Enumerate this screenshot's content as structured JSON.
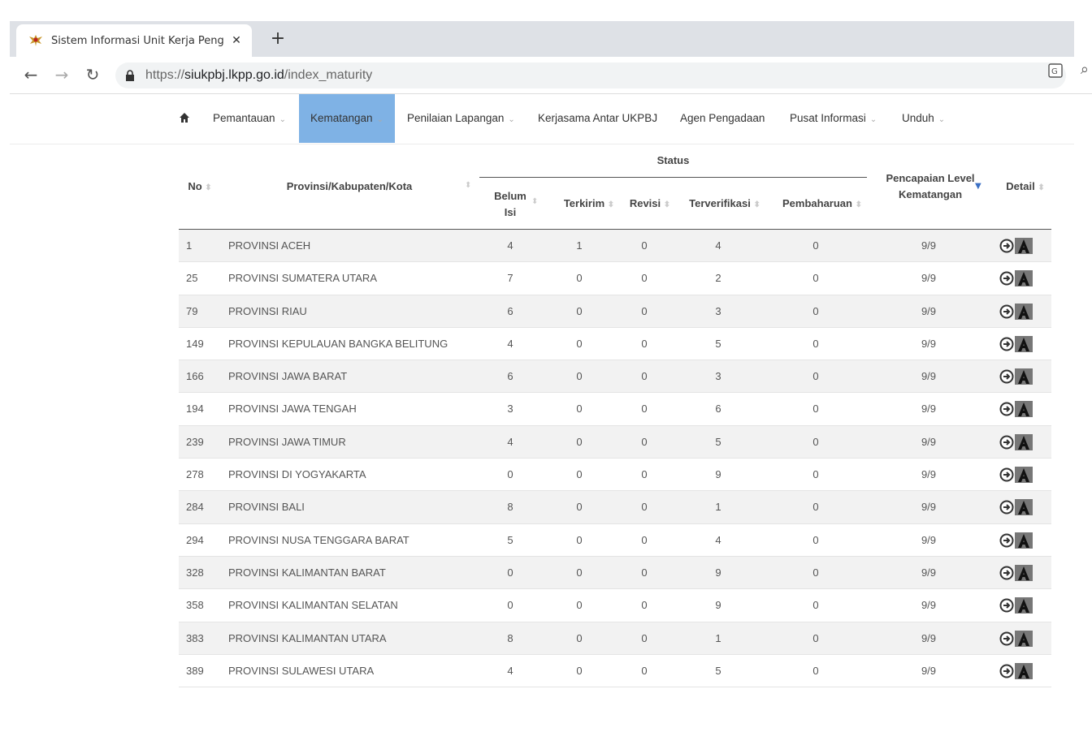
{
  "browser": {
    "tab_title": "Sistem Informasi Unit Kerja Peng",
    "url_proto": "https://",
    "url_host": "siukpbj.lkpp.go.id",
    "url_path": "/index_maturity"
  },
  "nav": {
    "items": [
      {
        "label": "Pemantauan",
        "chevron": true
      },
      {
        "label": "Kematangan",
        "chevron": true,
        "active": true
      },
      {
        "label": "Penilaian Lapangan",
        "chevron": true
      },
      {
        "label": "Kerjasama Antar UKPBJ",
        "chevron": false
      },
      {
        "label": "Agen Pengadaan",
        "chevron": false
      },
      {
        "label": "Pusat Informasi",
        "chevron": true
      },
      {
        "label": "Unduh",
        "chevron": true
      }
    ]
  },
  "table": {
    "headers": {
      "no": "No",
      "prov": "Provinsi/Kabupaten/Kota",
      "status": "Status",
      "belum_1": "Belum",
      "belum_2": "Isi",
      "terkirim": "Terkirim",
      "revisi": "Revisi",
      "terverifikasi": "Terverifikasi",
      "pembaharuan": "Pembaharuan",
      "level_1": "Pencapaian Level",
      "level_2": "Kematangan",
      "detail": "Detail"
    },
    "rows": [
      {
        "no": "1",
        "prov": "PROVINSI ACEH",
        "belum": "4",
        "terkirim": "1",
        "revisi": "0",
        "terverifikasi": "4",
        "pembaharuan": "0",
        "level": "9/9"
      },
      {
        "no": "25",
        "prov": "PROVINSI SUMATERA UTARA",
        "belum": "7",
        "terkirim": "0",
        "revisi": "0",
        "terverifikasi": "2",
        "pembaharuan": "0",
        "level": "9/9"
      },
      {
        "no": "79",
        "prov": "PROVINSI RIAU",
        "belum": "6",
        "terkirim": "0",
        "revisi": "0",
        "terverifikasi": "3",
        "pembaharuan": "0",
        "level": "9/9"
      },
      {
        "no": "149",
        "prov": "PROVINSI KEPULAUAN BANGKA BELITUNG",
        "belum": "4",
        "terkirim": "0",
        "revisi": "0",
        "terverifikasi": "5",
        "pembaharuan": "0",
        "level": "9/9"
      },
      {
        "no": "166",
        "prov": "PROVINSI JAWA BARAT",
        "belum": "6",
        "terkirim": "0",
        "revisi": "0",
        "terverifikasi": "3",
        "pembaharuan": "0",
        "level": "9/9"
      },
      {
        "no": "194",
        "prov": "PROVINSI JAWA TENGAH",
        "belum": "3",
        "terkirim": "0",
        "revisi": "0",
        "terverifikasi": "6",
        "pembaharuan": "0",
        "level": "9/9"
      },
      {
        "no": "239",
        "prov": "PROVINSI JAWA TIMUR",
        "belum": "4",
        "terkirim": "0",
        "revisi": "0",
        "terverifikasi": "5",
        "pembaharuan": "0",
        "level": "9/9"
      },
      {
        "no": "278",
        "prov": "PROVINSI DI YOGYAKARTA",
        "belum": "0",
        "terkirim": "0",
        "revisi": "0",
        "terverifikasi": "9",
        "pembaharuan": "0",
        "level": "9/9"
      },
      {
        "no": "284",
        "prov": "PROVINSI BALI",
        "belum": "8",
        "terkirim": "0",
        "revisi": "0",
        "terverifikasi": "1",
        "pembaharuan": "0",
        "level": "9/9"
      },
      {
        "no": "294",
        "prov": "PROVINSI NUSA TENGGARA BARAT",
        "belum": "5",
        "terkirim": "0",
        "revisi": "0",
        "terverifikasi": "4",
        "pembaharuan": "0",
        "level": "9/9"
      },
      {
        "no": "328",
        "prov": "PROVINSI KALIMANTAN BARAT",
        "belum": "0",
        "terkirim": "0",
        "revisi": "0",
        "terverifikasi": "9",
        "pembaharuan": "0",
        "level": "9/9"
      },
      {
        "no": "358",
        "prov": "PROVINSI KALIMANTAN SELATAN",
        "belum": "0",
        "terkirim": "0",
        "revisi": "0",
        "terverifikasi": "9",
        "pembaharuan": "0",
        "level": "9/9"
      },
      {
        "no": "383",
        "prov": "PROVINSI KALIMANTAN UTARA",
        "belum": "8",
        "terkirim": "0",
        "revisi": "0",
        "terverifikasi": "1",
        "pembaharuan": "0",
        "level": "9/9"
      },
      {
        "no": "389",
        "prov": "PROVINSI SULAWESI UTARA",
        "belum": "4",
        "terkirim": "0",
        "revisi": "0",
        "terverifikasi": "5",
        "pembaharuan": "0",
        "level": "9/9"
      }
    ]
  },
  "colors": {
    "nav_active": "#7fb2e5",
    "sort_active": "#3a6fc4"
  }
}
